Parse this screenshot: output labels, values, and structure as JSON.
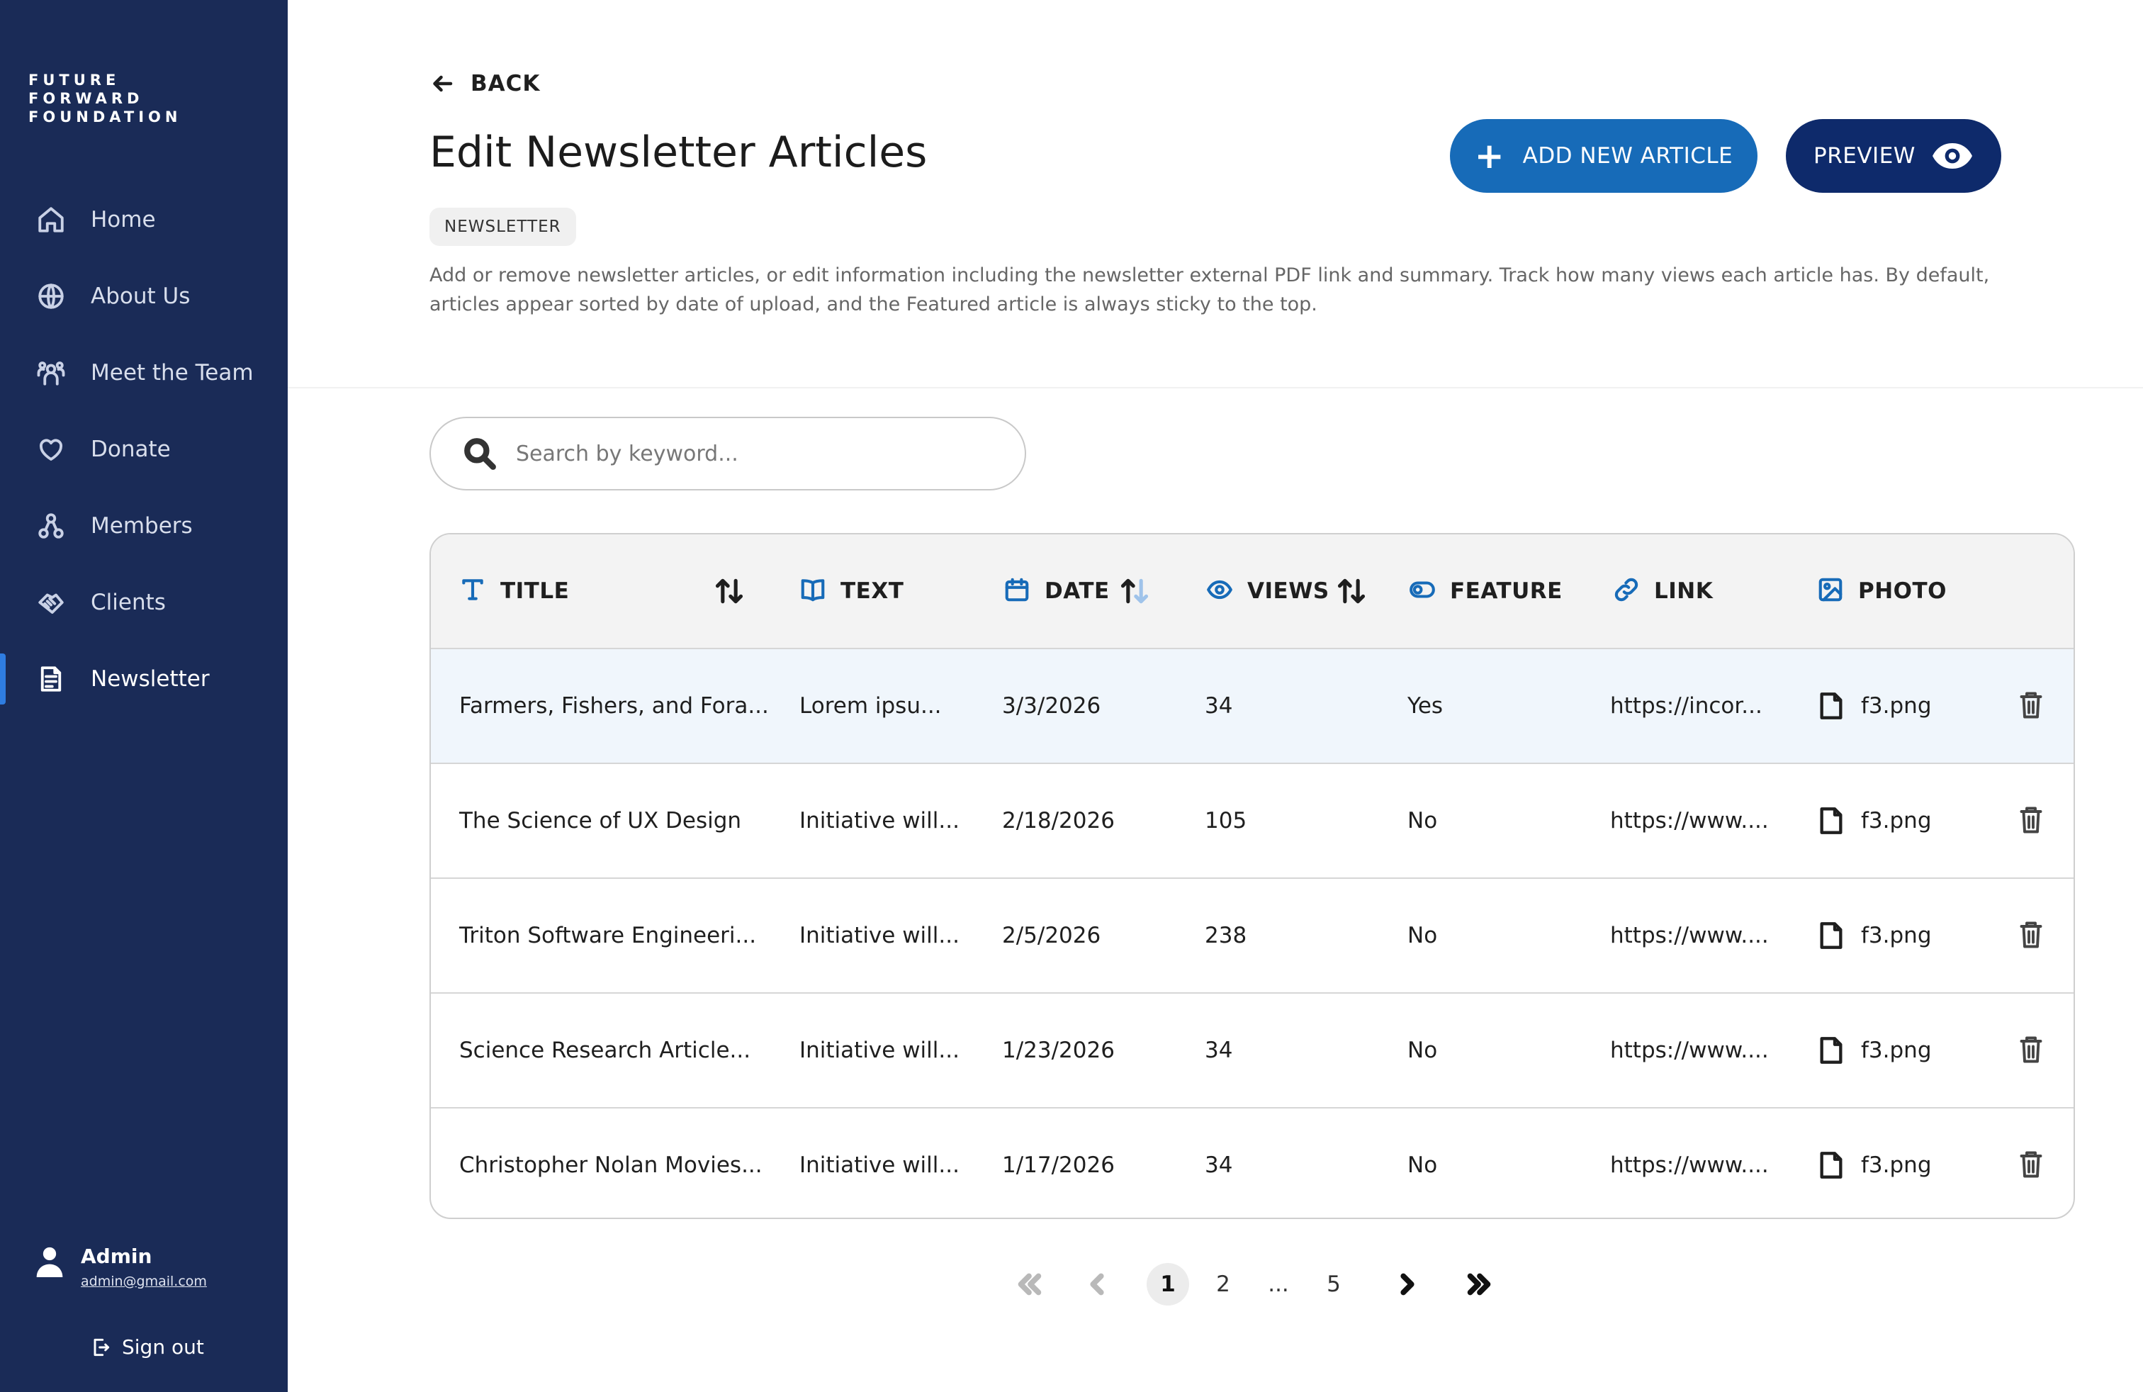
{
  "brand": {
    "line1": "FUTURE",
    "line2": "FORWARD",
    "line3": "FOUNDATION"
  },
  "sidebar": {
    "items": [
      {
        "label": "Home",
        "icon": "home-icon"
      },
      {
        "label": "About Us",
        "icon": "globe-icon"
      },
      {
        "label": "Meet the Team",
        "icon": "team-icon"
      },
      {
        "label": "Donate",
        "icon": "heart-icon"
      },
      {
        "label": "Members",
        "icon": "members-icon"
      },
      {
        "label": "Clients",
        "icon": "handshake-icon"
      },
      {
        "label": "Newsletter",
        "icon": "newsletter-icon",
        "active": true
      }
    ],
    "user": {
      "name": "Admin",
      "email": "admin@gmail.com"
    },
    "sign_out_label": "Sign out"
  },
  "header": {
    "back_label": "BACK",
    "title": "Edit Newsletter Articles",
    "tag": "NEWSLETTER",
    "description": "Add or remove newsletter articles, or edit information including the newsletter external PDF link and summary. Track how many views each article has. By default, articles appear sorted by date of upload, and the Featured article is always sticky to the top.",
    "add_button_label": "ADD NEW ARTICLE",
    "preview_button_label": "PREVIEW"
  },
  "search": {
    "placeholder": "Search by keyword..."
  },
  "table": {
    "columns": [
      {
        "label": "TITLE",
        "icon": "text-type-icon",
        "sortable": true
      },
      {
        "label": "TEXT",
        "icon": "book-icon",
        "sortable": false
      },
      {
        "label": "DATE",
        "icon": "calendar-icon",
        "sortable": true,
        "sort_direction": "ascending"
      },
      {
        "label": "VIEWS",
        "icon": "eye-icon",
        "sortable": true
      },
      {
        "label": "FEATURE",
        "icon": "toggle-icon",
        "sortable": false
      },
      {
        "label": "LINK",
        "icon": "link-icon",
        "sortable": false
      },
      {
        "label": "PHOTO",
        "icon": "image-icon",
        "sortable": false
      }
    ],
    "rows": [
      {
        "title": "Farmers, Fishers, and Fora...",
        "text": "Lorem ipsu...",
        "date": "3/3/2026",
        "views": "34",
        "feature": "Yes",
        "link": "https://incor...",
        "photo": "f3.png",
        "highlighted": true
      },
      {
        "title": "The Science of UX Design",
        "text": "Initiative will...",
        "date": "2/18/2026",
        "views": "105",
        "feature": "No",
        "link": "https://www....",
        "photo": "f3.png"
      },
      {
        "title": "Triton Software Engineeri...",
        "text": "Initiative will...",
        "date": "2/5/2026",
        "views": "238",
        "feature": "No",
        "link": "https://www....",
        "photo": "f3.png"
      },
      {
        "title": "Science Research Article...",
        "text": "Initiative will...",
        "date": "1/23/2026",
        "views": "34",
        "feature": "No",
        "link": "https://www....",
        "photo": "f3.png"
      },
      {
        "title": "Christopher Nolan Movies...",
        "text": "Initiative will...",
        "date": "1/17/2026",
        "views": "34",
        "feature": "No",
        "link": "https://www....",
        "photo": "f3.png"
      }
    ]
  },
  "pagination": {
    "pages": [
      "1",
      "2",
      "...",
      "5"
    ],
    "current": "1"
  },
  "colors": {
    "sidebar": "#1a2b57",
    "accent": "#176bb8",
    "preview": "#0e2a6b",
    "active_marker": "#2f7de1"
  }
}
